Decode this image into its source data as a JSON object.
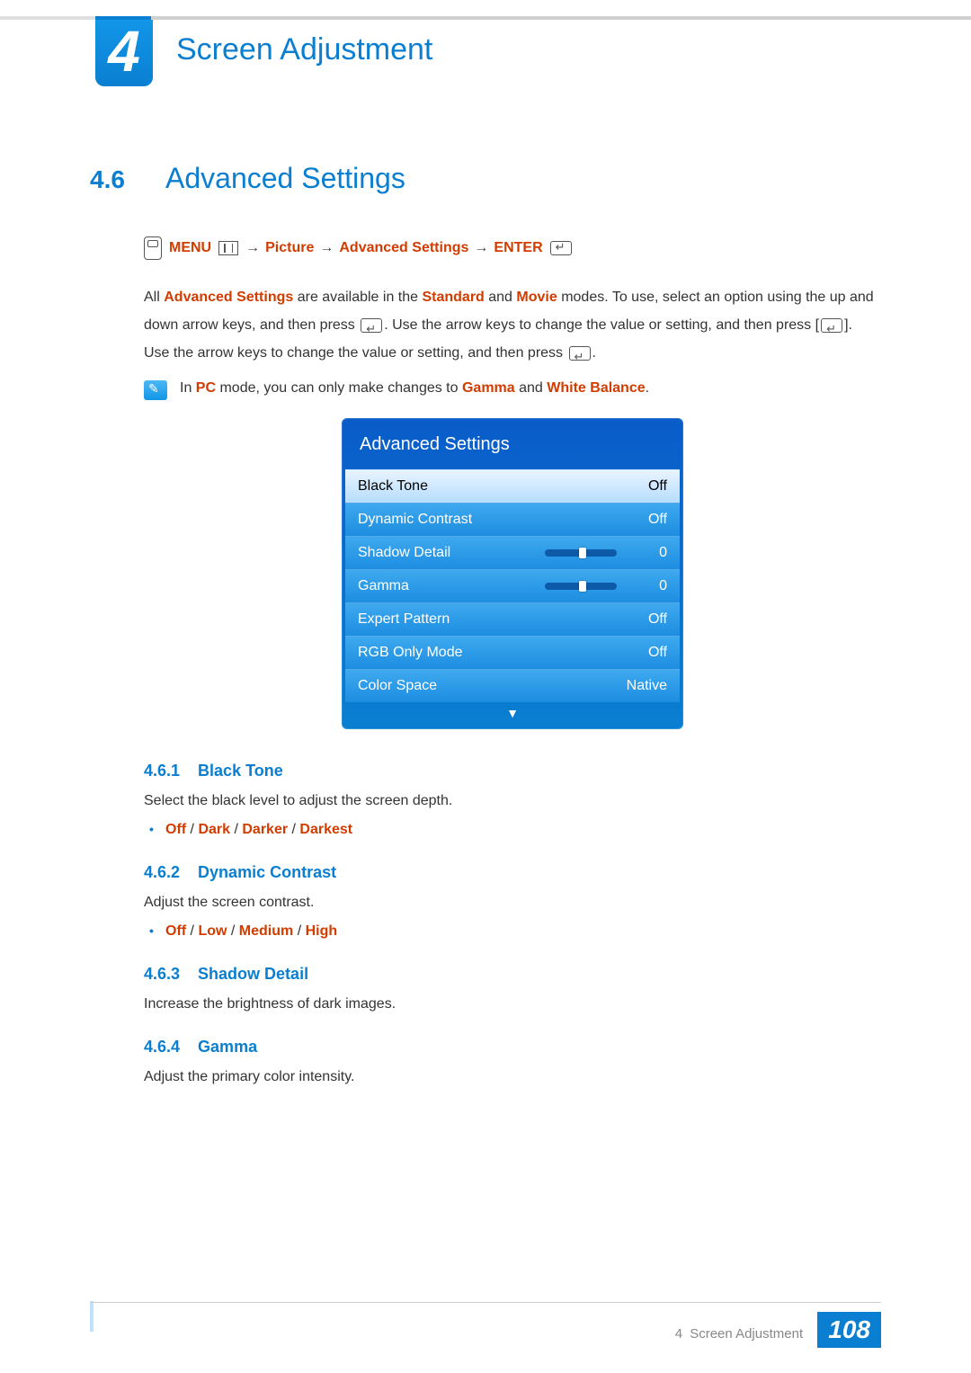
{
  "chapter": {
    "number": "4",
    "title": "Screen Adjustment"
  },
  "section": {
    "number": "4.6",
    "title": "Advanced Settings"
  },
  "nav": {
    "menu": "MENU",
    "picture": "Picture",
    "advanced": "Advanced Settings",
    "enter": "ENTER",
    "arrow": "→"
  },
  "intro": {
    "pre": "All ",
    "adv": "Advanced Settings",
    "mid1": " are available in the ",
    "std": "Standard",
    "mid2": " and ",
    "mov": "Movie",
    "post1": " modes. To use, select an option using the up and down arrow keys, and then press ",
    "post2": ". Use the arrow keys to change the value or setting, and then press [",
    "post3": "]. Use the arrow keys to change the value or setting, and then press ",
    "post4": "."
  },
  "note": {
    "pre": "In ",
    "pc": "PC",
    "mid": " mode, you can only make changes to ",
    "g": "Gamma",
    "and": " and ",
    "wb": "White Balance",
    "post": "."
  },
  "osd": {
    "title": "Advanced Settings",
    "items": [
      {
        "label": "Black Tone",
        "value": "Off",
        "type": "value",
        "selected": true
      },
      {
        "label": "Dynamic Contrast",
        "value": "Off",
        "type": "value"
      },
      {
        "label": "Shadow Detail",
        "value": "0",
        "type": "slider"
      },
      {
        "label": "Gamma",
        "value": "0",
        "type": "slider"
      },
      {
        "label": "Expert Pattern",
        "value": "Off",
        "type": "value"
      },
      {
        "label": "RGB Only Mode",
        "value": "Off",
        "type": "value"
      },
      {
        "label": "Color Space",
        "value": "Native",
        "type": "value"
      }
    ],
    "more": "▼"
  },
  "subs": {
    "s1": {
      "num": "4.6.1",
      "title": "Black Tone",
      "body": "Select the black level to adjust the screen depth.",
      "opts": [
        "Off",
        "Dark",
        "Darker",
        "Darkest"
      ]
    },
    "s2": {
      "num": "4.6.2",
      "title": "Dynamic Contrast",
      "body": "Adjust the screen contrast.",
      "opts": [
        "Off",
        "Low",
        "Medium",
        "High"
      ]
    },
    "s3": {
      "num": "4.6.3",
      "title": "Shadow Detail",
      "body": "Increase the brightness of dark images."
    },
    "s4": {
      "num": "4.6.4",
      "title": "Gamma",
      "body": "Adjust the primary color intensity."
    }
  },
  "footer": {
    "chapter_num": "4",
    "chapter_title": "Screen Adjustment",
    "page": "108"
  },
  "sep": " / "
}
